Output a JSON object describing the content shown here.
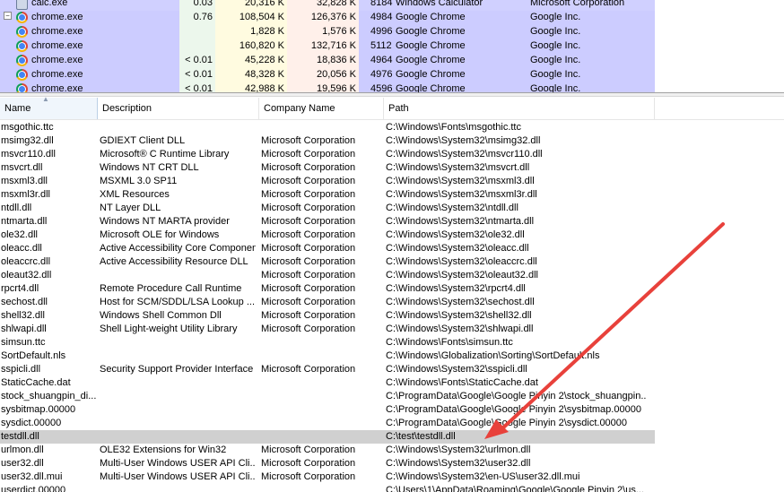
{
  "processes": [
    {
      "name": "calc.exe",
      "icon": "calculator-icon",
      "cpu": "0.03",
      "private": "20,316 K",
      "working": "32,828 K",
      "pid": "8184",
      "description": "Windows Calculator",
      "company": "Microsoft Corporation",
      "expander": ""
    },
    {
      "name": "chrome.exe",
      "icon": "chrome-icon",
      "cpu": "0.76",
      "private": "108,504 K",
      "working": "126,376 K",
      "pid": "4984",
      "description": "Google Chrome",
      "company": "Google Inc.",
      "expander": "−"
    },
    {
      "name": "chrome.exe",
      "icon": "chrome-icon",
      "cpu": "",
      "private": "1,828 K",
      "working": "1,576 K",
      "pid": "4996",
      "description": "Google Chrome",
      "company": "Google Inc.",
      "expander": ""
    },
    {
      "name": "chrome.exe",
      "icon": "chrome-icon",
      "cpu": "",
      "private": "160,820 K",
      "working": "132,716 K",
      "pid": "5112",
      "description": "Google Chrome",
      "company": "Google Inc.",
      "expander": ""
    },
    {
      "name": "chrome.exe",
      "icon": "chrome-icon",
      "cpu": "< 0.01",
      "private": "45,228 K",
      "working": "18,836 K",
      "pid": "4964",
      "description": "Google Chrome",
      "company": "Google Inc.",
      "expander": ""
    },
    {
      "name": "chrome.exe",
      "icon": "chrome-icon",
      "cpu": "< 0.01",
      "private": "48,328 K",
      "working": "20,056 K",
      "pid": "4976",
      "description": "Google Chrome",
      "company": "Google Inc.",
      "expander": ""
    },
    {
      "name": "chrome.exe",
      "icon": "chrome-icon",
      "cpu": "< 0.01",
      "private": "42,988 K",
      "working": "19,596 K",
      "pid": "4596",
      "description": "Google Chrome",
      "company": "Google Inc.",
      "expander": ""
    }
  ],
  "colors": {
    "calc_row": "#d0d0ff",
    "chrome_row": "#ccccff",
    "cpu_col": "#ecf7ec",
    "private_col": "#fffbe0",
    "working_col": "#fff0ea",
    "selected_row": "#d0d0d0",
    "arrow": "#e8413b"
  },
  "dll_headers": {
    "name": "Name",
    "description": "Description",
    "company": "Company Name",
    "path": "Path"
  },
  "dlls": [
    {
      "name": "msgothic.ttc",
      "description": "",
      "company": "",
      "path": "C:\\Windows\\Fonts\\msgothic.ttc"
    },
    {
      "name": "msimg32.dll",
      "description": "GDIEXT Client DLL",
      "company": "Microsoft Corporation",
      "path": "C:\\Windows\\System32\\msimg32.dll"
    },
    {
      "name": "msvcr110.dll",
      "description": "Microsoft® C Runtime Library",
      "company": "Microsoft Corporation",
      "path": "C:\\Windows\\System32\\msvcr110.dll"
    },
    {
      "name": "msvcrt.dll",
      "description": "Windows NT CRT DLL",
      "company": "Microsoft Corporation",
      "path": "C:\\Windows\\System32\\msvcrt.dll"
    },
    {
      "name": "msxml3.dll",
      "description": "MSXML 3.0 SP11",
      "company": "Microsoft Corporation",
      "path": "C:\\Windows\\System32\\msxml3.dll"
    },
    {
      "name": "msxml3r.dll",
      "description": "XML Resources",
      "company": "Microsoft Corporation",
      "path": "C:\\Windows\\System32\\msxml3r.dll"
    },
    {
      "name": "ntdll.dll",
      "description": "NT Layer DLL",
      "company": "Microsoft Corporation",
      "path": "C:\\Windows\\System32\\ntdll.dll"
    },
    {
      "name": "ntmarta.dll",
      "description": "Windows NT MARTA provider",
      "company": "Microsoft Corporation",
      "path": "C:\\Windows\\System32\\ntmarta.dll"
    },
    {
      "name": "ole32.dll",
      "description": "Microsoft OLE for Windows",
      "company": "Microsoft Corporation",
      "path": "C:\\Windows\\System32\\ole32.dll"
    },
    {
      "name": "oleacc.dll",
      "description": "Active Accessibility Core Component",
      "company": "Microsoft Corporation",
      "path": "C:\\Windows\\System32\\oleacc.dll"
    },
    {
      "name": "oleaccrc.dll",
      "description": "Active Accessibility Resource DLL",
      "company": "Microsoft Corporation",
      "path": "C:\\Windows\\System32\\oleaccrc.dll"
    },
    {
      "name": "oleaut32.dll",
      "description": "",
      "company": "Microsoft Corporation",
      "path": "C:\\Windows\\System32\\oleaut32.dll"
    },
    {
      "name": "rpcrt4.dll",
      "description": "Remote Procedure Call Runtime",
      "company": "Microsoft Corporation",
      "path": "C:\\Windows\\System32\\rpcrt4.dll"
    },
    {
      "name": "sechost.dll",
      "description": "Host for SCM/SDDL/LSA Lookup ...",
      "company": "Microsoft Corporation",
      "path": "C:\\Windows\\System32\\sechost.dll"
    },
    {
      "name": "shell32.dll",
      "description": "Windows Shell Common Dll",
      "company": "Microsoft Corporation",
      "path": "C:\\Windows\\System32\\shell32.dll"
    },
    {
      "name": "shlwapi.dll",
      "description": "Shell Light-weight Utility Library",
      "company": "Microsoft Corporation",
      "path": "C:\\Windows\\System32\\shlwapi.dll"
    },
    {
      "name": "simsun.ttc",
      "description": "",
      "company": "",
      "path": "C:\\Windows\\Fonts\\simsun.ttc"
    },
    {
      "name": "SortDefault.nls",
      "description": "",
      "company": "",
      "path": "C:\\Windows\\Globalization\\Sorting\\SortDefault.nls"
    },
    {
      "name": "sspicli.dll",
      "description": "Security Support Provider Interface",
      "company": "Microsoft Corporation",
      "path": "C:\\Windows\\System32\\sspicli.dll"
    },
    {
      "name": "StaticCache.dat",
      "description": "",
      "company": "",
      "path": "C:\\Windows\\Fonts\\StaticCache.dat"
    },
    {
      "name": "stock_shuangpin_di...",
      "description": "",
      "company": "",
      "path": "C:\\ProgramData\\Google\\Google Pinyin 2\\stock_shuangpin..."
    },
    {
      "name": "sysbitmap.00000",
      "description": "",
      "company": "",
      "path": "C:\\ProgramData\\Google\\Google Pinyin 2\\sysbitmap.00000"
    },
    {
      "name": "sysdict.00000",
      "description": "",
      "company": "",
      "path": "C:\\ProgramData\\Google\\Google Pinyin 2\\sysdict.00000"
    },
    {
      "name": "testdll.dll",
      "description": "",
      "company": "",
      "path": "C:\\test\\testdll.dll",
      "selected": true
    },
    {
      "name": "urlmon.dll",
      "description": "OLE32 Extensions for Win32",
      "company": "Microsoft Corporation",
      "path": "C:\\Windows\\System32\\urlmon.dll"
    },
    {
      "name": "user32.dll",
      "description": "Multi-User Windows USER API Cli...",
      "company": "Microsoft Corporation",
      "path": "C:\\Windows\\System32\\user32.dll"
    },
    {
      "name": "user32.dll.mui",
      "description": "Multi-User Windows USER API Cli...",
      "company": "Microsoft Corporation",
      "path": "C:\\Windows\\System32\\en-US\\user32.dll.mui"
    },
    {
      "name": "userdict.00000",
      "description": "",
      "company": "",
      "path": "C:\\Users\\1\\AppData\\Roaming\\Google\\Google Pinyin 2\\us..."
    }
  ]
}
